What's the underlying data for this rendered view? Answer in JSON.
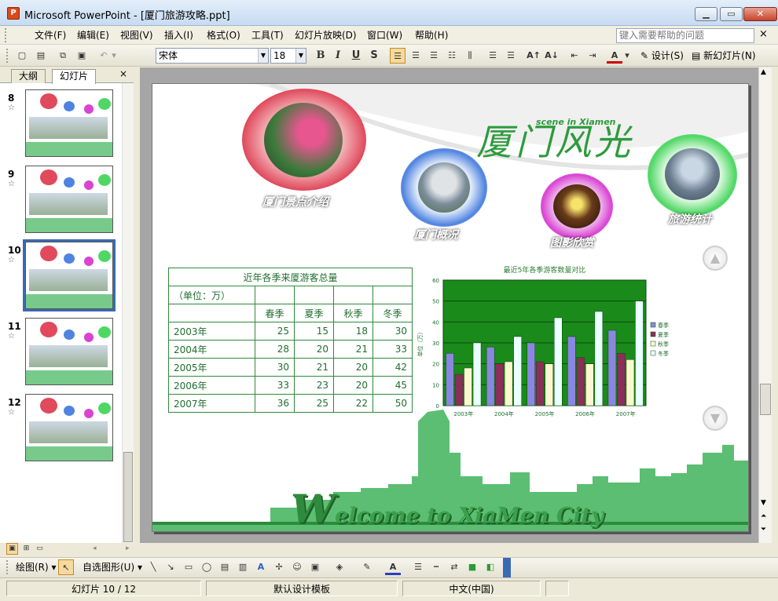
{
  "window": {
    "title": "Microsoft PowerPoint - [厦门旅游攻略.ppt]"
  },
  "menu": {
    "items": [
      "文件(F)",
      "编辑(E)",
      "视图(V)",
      "插入(I)",
      "格式(O)",
      "工具(T)",
      "幻灯片放映(D)",
      "窗口(W)",
      "帮助(H)"
    ],
    "help_placeholder": "键入需要帮助的问题"
  },
  "toolbar": {
    "font": "宋体",
    "size": "18",
    "bold": "B",
    "italic": "I",
    "underline": "U",
    "shadow": "S",
    "design": "设计(S)",
    "new_slide": "新幻灯片(N)"
  },
  "leftpane": {
    "tabs": [
      "大纲",
      "幻灯片"
    ],
    "close": "×",
    "thumbnails": [
      "8",
      "9",
      "10",
      "11",
      "12"
    ],
    "selected": "10"
  },
  "slide": {
    "title_cn": "厦门风光",
    "title_en": "scene in Xiamen",
    "nav_circles": [
      "厦门景点介绍",
      "厦门概况",
      "图影欣赏",
      "旅游统计"
    ],
    "welcome_first": "W",
    "welcome_rest": "elcome to XiaMen City",
    "table": {
      "title": "近年各季来厦游客总量",
      "unit": "（单位：万）",
      "headers": [
        "春季",
        "夏季",
        "秋季",
        "冬季"
      ],
      "rows": [
        {
          "year": "2003年",
          "values": [
            "25",
            "15",
            "18",
            "30"
          ]
        },
        {
          "year": "2004年",
          "values": [
            "28",
            "20",
            "21",
            "33"
          ]
        },
        {
          "year": "2005年",
          "values": [
            "30",
            "21",
            "20",
            "42"
          ]
        },
        {
          "year": "2006年",
          "values": [
            "33",
            "23",
            "20",
            "45"
          ]
        },
        {
          "year": "2007年",
          "values": [
            "36",
            "25",
            "22",
            "50"
          ]
        }
      ]
    }
  },
  "chart_data": {
    "type": "bar",
    "title": "最近5年各季游客数量对比",
    "ylabel": "单位（万）",
    "categories": [
      "2003年",
      "2004年",
      "2005年",
      "2006年",
      "2007年"
    ],
    "series": [
      {
        "name": "春季",
        "values": [
          25,
          28,
          30,
          33,
          36
        ],
        "color": "#8a87e0"
      },
      {
        "name": "夏季",
        "values": [
          15,
          20,
          21,
          23,
          25
        ],
        "color": "#8a2e5a"
      },
      {
        "name": "秋季",
        "values": [
          18,
          21,
          20,
          20,
          22
        ],
        "color": "#fbf8cf"
      },
      {
        "name": "冬季",
        "values": [
          30,
          33,
          42,
          45,
          50
        ],
        "color": "#eaffff"
      }
    ],
    "ylim": [
      0,
      60
    ],
    "yticks": [
      0,
      10,
      20,
      30,
      40,
      50,
      60
    ],
    "plot_background": "#1a8a1a",
    "grid": true,
    "legend": "right"
  },
  "drawbar": {
    "draw": "绘图(R)",
    "autoshape": "自选图形(U)"
  },
  "status": {
    "slide": "幻灯片 10 / 12",
    "template": "默认设计模板",
    "language": "中文(中国)"
  }
}
